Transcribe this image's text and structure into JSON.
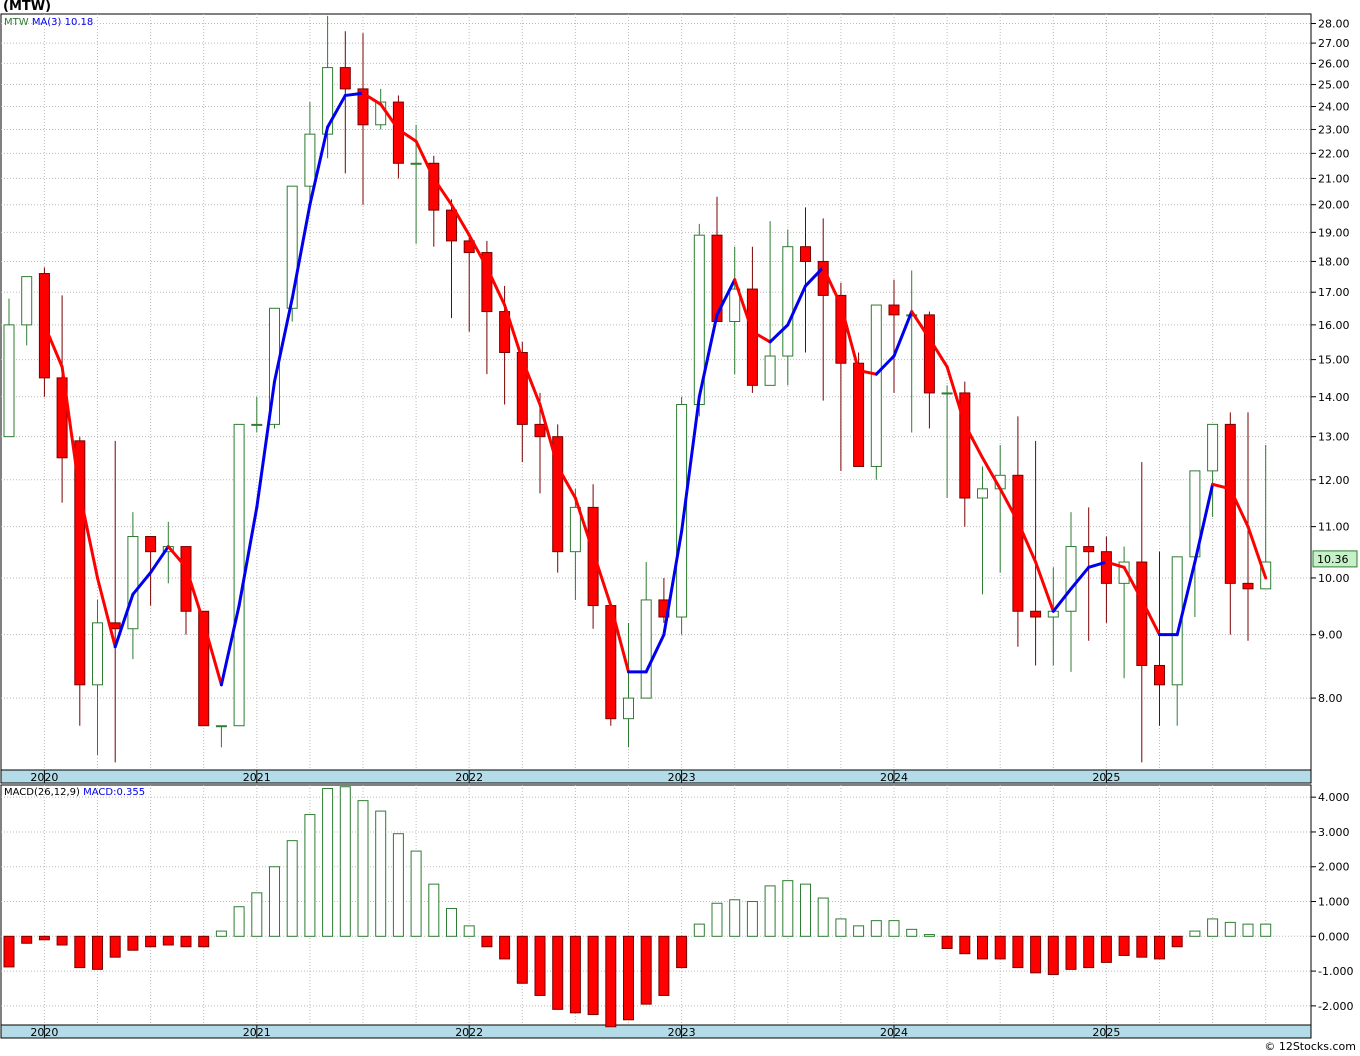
{
  "ticker_title": "(MTW)",
  "footer": "© 12Stocks.com",
  "price_panel": {
    "label": "MTW",
    "ma_label": "MA(3)",
    "ma_value": "10.18",
    "last_price": "10.36",
    "y_ticks": [
      "8.00",
      "9.00",
      "10.00",
      "11.00",
      "12.00",
      "13.00",
      "14.00",
      "15.00",
      "16.00",
      "17.00",
      "18.00",
      "19.00",
      "20.00",
      "21.00",
      "22.00",
      "23.00",
      "24.00",
      "25.00",
      "26.00",
      "27.00",
      "28.00"
    ],
    "scale": "log"
  },
  "macd_panel": {
    "label": "MACD(26,12,9)",
    "macd_label": "MACD:0.355",
    "y_ticks": [
      "4.000",
      "3.000",
      "2.000",
      "1.000",
      "0.000",
      "-1.000",
      "-2.000"
    ]
  },
  "x_labels": [
    "2020",
    "2021",
    "2022",
    "2023",
    "2024",
    "2025"
  ],
  "colors": {
    "up_candle": "#2e7d32",
    "down_candle": "#ff0000",
    "ma_up": "#0000ee",
    "ma_down": "#ff0000",
    "grid": "#bbbbbb",
    "axis_band": "#b3dbe8",
    "last_price_box": "#c8f0c8"
  },
  "chart_data": {
    "type": "candlestick",
    "period": "monthly",
    "x": [
      "2019-11",
      "2019-12",
      "2020-01",
      "2020-02",
      "2020-03",
      "2020-04",
      "2020-05",
      "2020-06",
      "2020-07",
      "2020-08",
      "2020-09",
      "2020-10",
      "2020-11",
      "2020-12",
      "2021-01",
      "2021-02",
      "2021-03",
      "2021-04",
      "2021-05",
      "2021-06",
      "2021-07",
      "2021-08",
      "2021-09",
      "2021-10",
      "2021-11",
      "2021-12",
      "2022-01",
      "2022-02",
      "2022-03",
      "2022-04",
      "2022-05",
      "2022-06",
      "2022-07",
      "2022-08",
      "2022-09",
      "2022-10",
      "2022-11",
      "2022-12",
      "2023-01",
      "2023-02",
      "2023-03",
      "2023-04",
      "2023-05",
      "2023-06",
      "2023-07",
      "2023-08",
      "2023-09",
      "2023-10",
      "2023-11",
      "2023-12",
      "2024-01",
      "2024-02",
      "2024-03",
      "2024-04",
      "2024-05",
      "2024-06",
      "2024-07",
      "2024-08",
      "2024-09",
      "2024-10",
      "2024-11",
      "2024-12",
      "2025-01",
      "2025-02",
      "2025-03",
      "2025-04",
      "2025-05",
      "2025-06",
      "2025-07",
      "2025-08",
      "2025-09",
      "2025-10"
    ],
    "open": [
      13.0,
      16.0,
      17.6,
      14.5,
      12.9,
      8.2,
      9.2,
      9.1,
      10.8,
      10.5,
      10.6,
      9.4,
      7.6,
      7.6,
      13.3,
      13.3,
      16.5,
      20.7,
      22.8,
      25.8,
      24.8,
      23.2,
      24.2,
      21.6,
      21.6,
      19.8,
      18.7,
      18.3,
      16.4,
      15.2,
      13.3,
      13.0,
      10.5,
      11.4,
      9.5,
      7.7,
      8.0,
      9.6,
      9.3,
      13.8,
      18.9,
      16.1,
      17.1,
      14.3,
      15.1,
      18.5,
      18.0,
      16.9,
      14.9,
      12.3,
      16.6,
      16.3,
      16.3,
      14.1,
      14.1,
      11.6,
      11.8,
      12.1,
      9.4,
      9.3,
      9.4,
      10.6,
      10.5,
      9.9,
      10.3,
      8.5,
      8.2,
      10.4,
      12.2,
      13.3,
      9.9,
      9.8,
      10.3
    ],
    "high": [
      16.8,
      17.4,
      17.8,
      16.9,
      13.0,
      9.6,
      12.9,
      11.3,
      10.8,
      11.1,
      10.5,
      9.4,
      7.6,
      11.7,
      14.0,
      16.5,
      20.1,
      24.2,
      28.4,
      27.6,
      27.5,
      24.8,
      24.5,
      23.2,
      21.9,
      20.2,
      18.8,
      18.7,
      17.2,
      15.5,
      14.1,
      13.3,
      11.8,
      11.9,
      9.5,
      9.2,
      10.3,
      10.0,
      14.0,
      19.3,
      20.3,
      18.5,
      18.5,
      19.4,
      19.1,
      19.9,
      19.5,
      17.3,
      15.2,
      13.8,
      17.4,
      17.7,
      16.4,
      14.3,
      14.4,
      12.3,
      12.8,
      13.5,
      12.9,
      10.2,
      11.3,
      11.4,
      10.8,
      10.6,
      12.4,
      10.5,
      8.7,
      10.6,
      12.5,
      13.6,
      13.6,
      12.8,
      12.3
    ],
    "low": [
      13.0,
      15.4,
      14.0,
      11.5,
      7.6,
      7.2,
      7.1,
      8.6,
      9.5,
      9.9,
      9.0,
      8.3,
      7.3,
      7.8,
      13.1,
      13.2,
      16.1,
      19.9,
      21.8,
      21.2,
      20.0,
      23.0,
      21.0,
      18.6,
      18.5,
      16.2,
      15.8,
      14.6,
      13.8,
      12.4,
      11.7,
      10.1,
      9.6,
      9.1,
      7.6,
      7.3,
      8.8,
      9.2,
      9.0,
      13.5,
      16.6,
      14.6,
      14.1,
      14.3,
      14.3,
      15.2,
      13.9,
      12.2,
      12.5,
      12.0,
      14.1,
      13.1,
      13.2,
      11.6,
      11.0,
      9.7,
      10.1,
      8.8,
      8.5,
      8.5,
      8.4,
      8.9,
      9.2,
      8.3,
      7.1,
      7.6,
      7.6,
      9.3,
      11.2,
      9.0,
      8.9,
      9.8,
      10.3
    ],
    "close": [
      16.0,
      17.5,
      14.5,
      12.5,
      8.2,
      9.2,
      9.1,
      10.8,
      10.5,
      10.6,
      9.4,
      7.6,
      7.6,
      13.3,
      13.3,
      16.5,
      20.7,
      22.8,
      25.8,
      24.8,
      23.2,
      24.2,
      21.6,
      21.6,
      19.8,
      18.7,
      18.3,
      16.4,
      15.2,
      13.3,
      13.0,
      10.5,
      11.4,
      9.5,
      7.7,
      8.0,
      9.6,
      9.3,
      13.8,
      18.9,
      16.1,
      17.1,
      14.3,
      15.1,
      18.5,
      18.0,
      16.9,
      14.9,
      12.3,
      16.6,
      16.3,
      16.3,
      14.1,
      14.1,
      11.6,
      11.8,
      12.1,
      9.4,
      9.3,
      9.4,
      10.6,
      10.5,
      9.9,
      10.3,
      8.5,
      8.2,
      10.4,
      12.2,
      13.3,
      9.9,
      9.8,
      10.3,
      10.36
    ],
    "ma3": [
      null,
      null,
      16.0,
      14.8,
      11.7,
      10.0,
      8.8,
      9.7,
      10.1,
      10.6,
      10.2,
      9.2,
      8.2,
      9.5,
      11.4,
      14.4,
      16.8,
      20.0,
      23.1,
      24.5,
      24.6,
      24.1,
      23.0,
      22.5,
      21.0,
      20.0,
      18.9,
      17.8,
      16.6,
      15.0,
      13.8,
      12.3,
      11.6,
      10.5,
      9.5,
      8.4,
      8.4,
      9.0,
      10.9,
      14.0,
      16.3,
      17.4,
      15.8,
      15.5,
      16.0,
      17.2,
      17.8,
      16.6,
      14.7,
      14.6,
      15.1,
      16.4,
      15.6,
      14.8,
      13.3,
      12.5,
      11.8,
      11.1,
      10.3,
      9.4,
      9.8,
      10.2,
      10.3,
      10.2,
      9.6,
      9.0,
      9.0,
      10.3,
      11.9,
      11.8,
      11.0,
      10.0,
      10.18
    ],
    "macd_hist": [
      -0.88,
      -0.2,
      -0.1,
      -0.25,
      -0.9,
      -0.95,
      -0.6,
      -0.4,
      -0.3,
      -0.25,
      -0.3,
      -0.3,
      0.15,
      0.85,
      1.25,
      2.0,
      2.75,
      3.5,
      4.25,
      4.3,
      3.9,
      3.6,
      2.95,
      2.45,
      1.5,
      0.8,
      0.3,
      -0.3,
      -0.65,
      -1.35,
      -1.7,
      -2.1,
      -2.2,
      -2.25,
      -2.6,
      -2.4,
      -1.95,
      -1.7,
      -0.9,
      0.35,
      0.95,
      1.05,
      1.0,
      1.45,
      1.6,
      1.5,
      1.1,
      0.5,
      0.3,
      0.45,
      0.45,
      0.2,
      0.05,
      -0.35,
      -0.5,
      -0.65,
      -0.65,
      -0.9,
      -1.05,
      -1.1,
      -0.95,
      -0.9,
      -0.75,
      -0.55,
      -0.6,
      -0.65,
      -0.3,
      0.15,
      0.5,
      0.4,
      0.35,
      0.35,
      0.355
    ],
    "macd_line": [
      -0.88,
      -0.2,
      -0.1,
      -0.25,
      -0.9,
      -0.95,
      -0.6,
      -0.4,
      -0.3,
      -0.25,
      -0.3,
      -0.3,
      0.15,
      0.85,
      1.25,
      2.0,
      2.75,
      3.5,
      4.25,
      4.3,
      3.9,
      3.6,
      2.95,
      2.45,
      1.5,
      0.8,
      0.3,
      -0.3,
      -0.65,
      -1.35,
      -1.7,
      -2.1,
      -2.2,
      -2.25,
      -2.6,
      -2.4,
      -1.95,
      -1.7,
      -0.9,
      0.35,
      0.95,
      1.05,
      1.0,
      1.45,
      1.6,
      1.5,
      1.1,
      0.5,
      0.3,
      0.45,
      0.45,
      0.2,
      0.05,
      -0.35,
      -0.5,
      -0.65,
      -0.65,
      -0.9,
      -1.05,
      -1.1,
      -0.95,
      -0.9,
      -0.75,
      -0.55,
      -0.6,
      -0.65,
      -0.3,
      0.15,
      0.5,
      0.4,
      0.35,
      0.35,
      0.355
    ],
    "price_ylim": [
      7.0,
      28.5
    ],
    "macd_ylim": [
      -2.55,
      4.35
    ],
    "grid": true
  }
}
